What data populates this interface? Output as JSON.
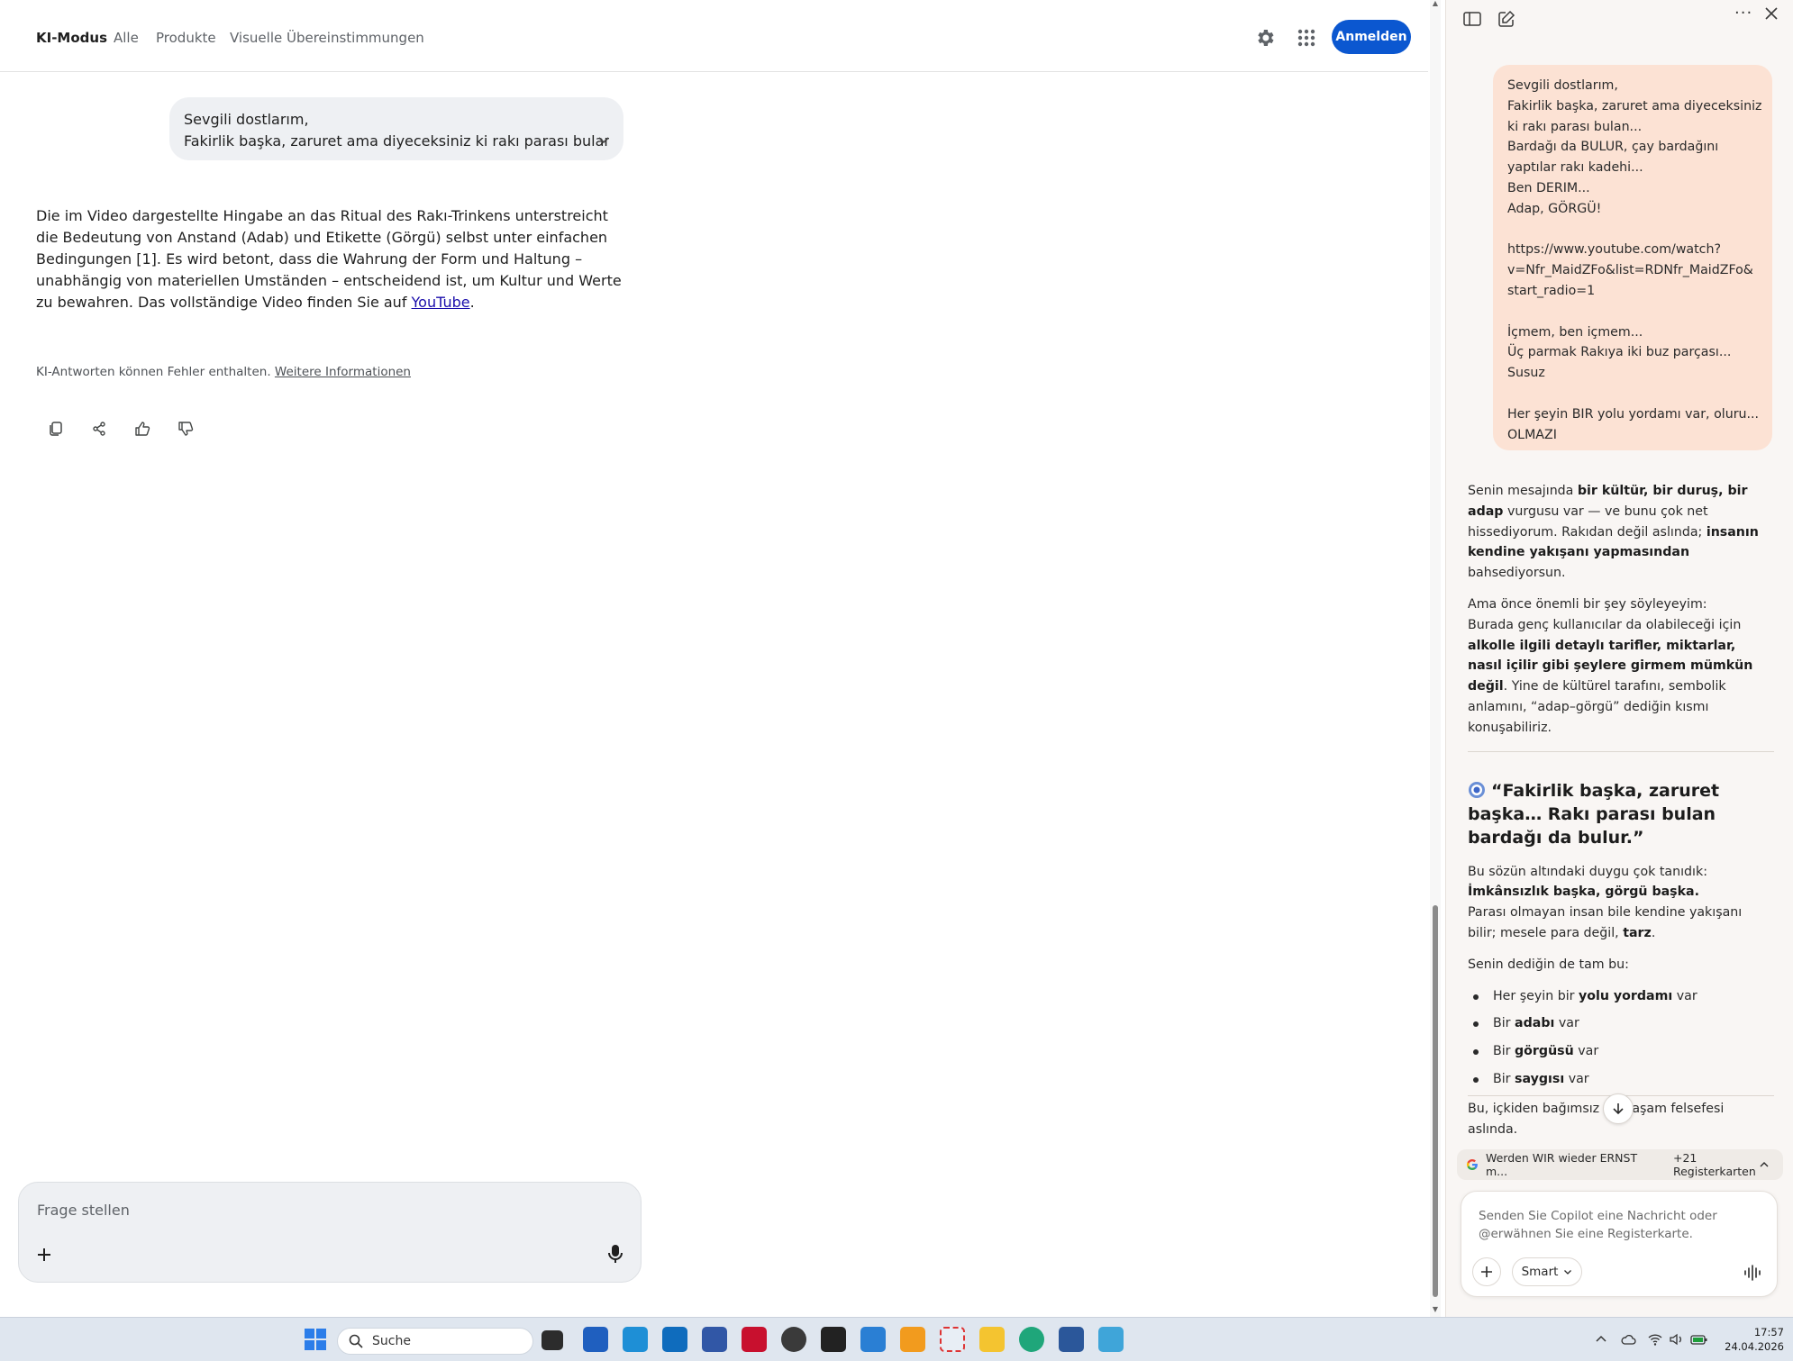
{
  "google": {
    "tabs": [
      "KI-Modus",
      "Alle",
      "Produkte",
      "Visuelle Übereinstimmungen"
    ],
    "signin_label": "Anmelden",
    "user_message": {
      "line1": "Sevgili dostlarım,",
      "line2": "Fakirlik başka, zaruret ama diyeceksiniz ki rakı parası bulan......"
    },
    "answer": {
      "text": "Die im Video dargestellte Hingabe an das Ritual des Rakı-Trinkens unterstreicht die Bedeutung von Anstand (Adab) und Etikette (Görgü) selbst unter einfachen Bedingungen [1]. Es wird betont, dass die Wahrung der Form und Haltung – unabhängig von materiellen Umständen – entscheidend ist, um Kultur und Werte zu bewahren. Das vollständige Video finden Sie auf ",
      "link": "YouTube",
      "end": "."
    },
    "disclaimer": "KI-Antworten können Fehler enthalten.",
    "disclaimer_link": "Weitere Informationen",
    "ask_placeholder": "Frage stellen"
  },
  "copilot": {
    "user_lines": [
      "Sevgili dostlarım,",
      "Fakirlik başka, zaruret ama diyeceksiniz",
      "ki rakı parası bulan...",
      "Bardağı da BULUR, çay bardağını",
      "yaptılar rakı kadehi...",
      "Ben DERIM...",
      "Adap, GÖRGÜ!",
      "",
      "https://www.youtube.com/watch?",
      "v=Nfr_MaidZFo&list=RDNfr_MaidZFo&",
      "start_radio=1",
      "",
      "İçmem, ben içmem...",
      "Üç parmak Rakıya iki buz parçası...",
      "Susuz",
      "",
      "Her şeyin BIR yolu yordamı var, oluru...",
      "OLMAZI"
    ],
    "p1": {
      "a": "Senin mesajında ",
      "b": "bir kültür, bir duruş, bir adap",
      "c": " vurgusu var — ve bunu çok net hissediyorum. Rakıdan değil aslında; ",
      "d": "insanın kendine yakışanı yapmasından",
      "e": " bahsediyorsun."
    },
    "p2": {
      "a": "Ama önce önemli bir şey söyleyeyim:",
      "b": "Burada genç kullanıcılar da olabileceği için ",
      "c": "alkolle ilgili detaylı tarifler, miktarlar, nasıl içilir gibi şeylere girmem mümkün değil",
      "d": ". Yine de kültürel tarafını, sembolik anlamını, “adap–görgü” dediğin kısmı konuşabiliriz."
    },
    "heading": "“Fakirlik başka, zaruret başka… Rakı parası bulan bardağı da bulur.”",
    "p3": {
      "a": "Bu sözün altındaki duygu çok tanıdık:",
      "b": "İmkânsızlık başka, görgü başka.",
      "c": "Parası olmayan insan bile kendine yakışanı bilir; mesele para değil, ",
      "d": "tarz",
      "e": "."
    },
    "p4": "Senin dediğin de tam bu:",
    "list": [
      {
        "pre": "Her şeyin bir ",
        "bold": "yolu yordamı",
        "post": " var"
      },
      {
        "pre": "Bir ",
        "bold": "adabı",
        "post": " var"
      },
      {
        "pre": "Bir ",
        "bold": "görgüsü",
        "post": " var"
      },
      {
        "pre": "Bir ",
        "bold": "saygısı",
        "post": " var"
      }
    ],
    "p5": "Bu, içkiden bağımsız bir yaşam felsefesi aslında.",
    "tabs_chip": {
      "title": "Werden WIR wieder ERNST m...",
      "count": "+21 Registerkarten"
    },
    "input_placeholder": "Senden Sie Copilot eine Nachricht oder @erwähnen Sie eine Registerkarte.",
    "smart_label": "Smart"
  },
  "taskbar": {
    "search_label": "Suche",
    "time": "17:57",
    "date": "24.04.2026"
  }
}
